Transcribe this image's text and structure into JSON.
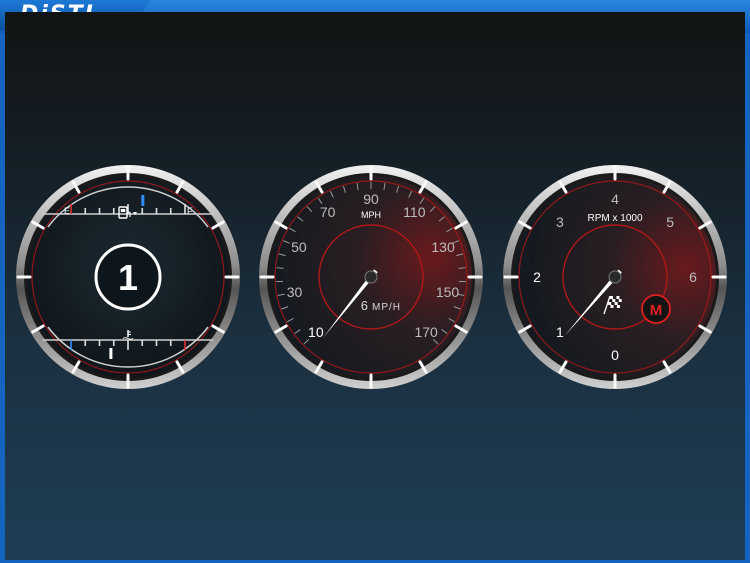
{
  "titlebar": {
    "logo_text": "DiSTI",
    "brand_color": "#1565c0"
  },
  "left_gauge": {
    "fuel": {
      "empty_label": "E",
      "full_label": "F",
      "icon": "fuel-pump-icon",
      "level": 0.63
    },
    "gear": "1",
    "temperature": {
      "icon": "coolant-temperature-icon",
      "level": 0.35
    }
  },
  "speedometer": {
    "unit_label": "MPH",
    "ticks": [
      "10",
      "30",
      "50",
      "70",
      "90",
      "110",
      "130",
      "150",
      "170"
    ],
    "digital_value": "6",
    "digital_unit": "MP/H",
    "speed_mph": 6
  },
  "tachometer": {
    "unit_label": "RPM x 1000",
    "ticks": [
      "0",
      "1",
      "2",
      "3",
      "4",
      "5",
      "6"
    ],
    "rpm_thousands": 0.9,
    "mode_label": "M",
    "icon": "checkered-flag-icon",
    "accent_color": "#e02020"
  }
}
